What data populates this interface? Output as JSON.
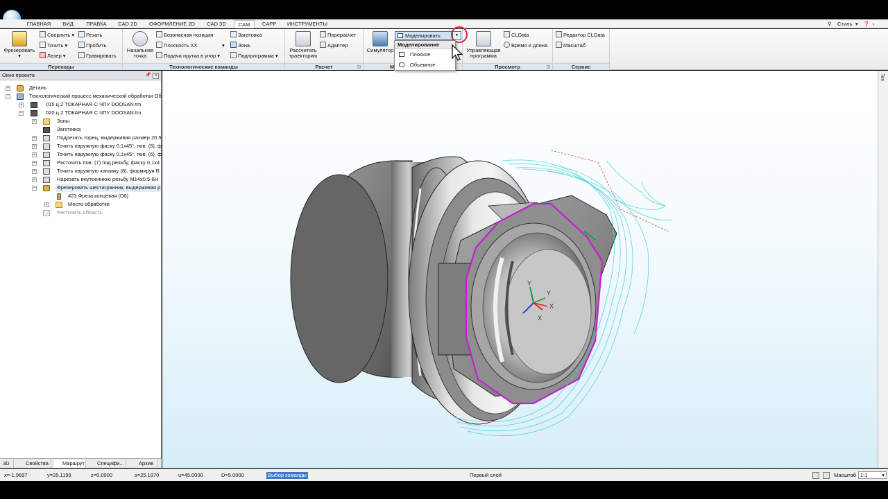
{
  "menu": {
    "tabs": [
      "ГЛАВНАЯ",
      "ВИД",
      "ПРАВКА",
      "CAD 2D",
      "ОФОРМЛЕНИЕ 2D",
      "CAD 3D",
      "CAM",
      "CAPP",
      "ИНСТРУМЕНТЫ"
    ],
    "active_tab": "CAM",
    "style_label": "Стиль"
  },
  "ribbon": {
    "perekhody": {
      "title": "Переходы",
      "mill": "Фрезеровать",
      "drill": "Сверлить",
      "cut": "Резать",
      "turn": "Точить",
      "punch": "Пробить",
      "laser": "Лазер",
      "engrave": "Гравировать"
    },
    "tech": {
      "title": "Технологические команды",
      "start_point": "Начальная точка",
      "safe_position": "Безопасная позиция",
      "plane_xx": "Плоскость XX",
      "bar_feed": "Подача прутка в упор",
      "blank": "Заготовка",
      "zone": "Зона",
      "subprogram": "Подпрограмма"
    },
    "raschet": {
      "title": "Расчет",
      "calc": "Рассчитать траекторию",
      "recalc": "Перерасчет",
      "adapter": "Адаптер"
    },
    "model": {
      "title": "Моделирование",
      "simulator": "Симулятор",
      "select_value": "Моделировать"
    },
    "prosmotr": {
      "title": "Просмотр",
      "control_prog": "Управляющая программа",
      "cldata": "CLData",
      "time_length": "Время и длина"
    },
    "service": {
      "title": "Сервис",
      "editor": "Редактор CLData",
      "scale": "Масштаб"
    }
  },
  "dropdown": {
    "header": "Моделирование",
    "items": [
      "Плоское",
      "Объемное"
    ]
  },
  "project": {
    "title": "Окно проекта",
    "tree": [
      {
        "label": "Деталь"
      },
      {
        "label": "Технологический процесс механической обработки Об"
      },
      {
        "label": "015 ц.2 ТОКАРНАЯ С ЧПУ DOOSAN tm"
      },
      {
        "label": "020 ц.2 ТОКАРНАЯ С ЧПУ DOOSAN tm"
      },
      {
        "label": "Зоны"
      },
      {
        "label": "Заготовка"
      },
      {
        "label": "Подрезать торец, выдерживая размер 20.5"
      },
      {
        "label": "Точить наружную фаску 0,1х45°, пов. (6), фа"
      },
      {
        "label": "Точить наружную фаску 0,1х45°, пов. (6), фа"
      },
      {
        "label": "Расточить пов. (7) под резьбу, фаску 0,1х4"
      },
      {
        "label": "Точить наружную канавку (8), формируя R"
      },
      {
        "label": "Нарезать внутреннюю резьбу M14x0.5-6H"
      },
      {
        "label": "Фрезеровать шестигранник, выдерживая р"
      },
      {
        "label": "#23 Фреза концевая (D6)"
      },
      {
        "label": "Место обработки"
      },
      {
        "label": "Расточить область"
      }
    ],
    "tabs": [
      "3D",
      "Свойства",
      "Маршрут",
      "Специфи...",
      "Архив"
    ]
  },
  "viewport": {
    "axis_labels": [
      "Y",
      "Y",
      "X",
      "X"
    ],
    "side_tab": "Тех"
  },
  "status": {
    "x": "x=-1.9697",
    "y": "y=25.1199",
    "z": "z=0.0000",
    "s": "s=25.1970",
    "u": "u=45.0000",
    "d": "D=5.0000",
    "command": "Выбор команды",
    "layer": "Первый слой",
    "scale_label": "Масштаб",
    "scale_value": "1:1"
  }
}
